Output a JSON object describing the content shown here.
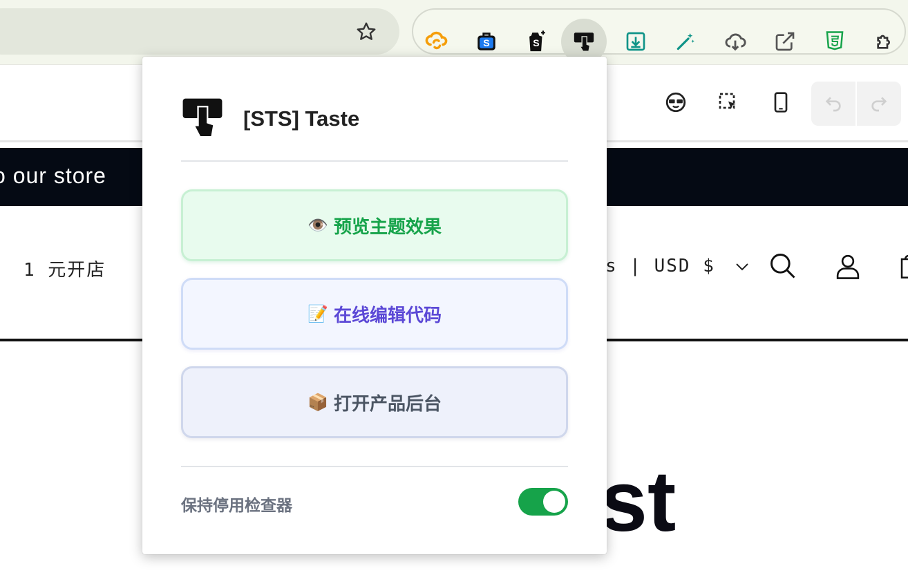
{
  "browser": {
    "extensions": [
      "sync-icon",
      "briefcase-s-icon",
      "shopify-icon",
      "sts-taste-icon",
      "download-box-icon",
      "magic-wand-icon",
      "cloud-download-icon",
      "open-external-icon",
      "html5-icon",
      "puzzle-icon"
    ],
    "active_extension": "sts-taste-icon"
  },
  "page": {
    "banner_text": "o our store",
    "nav_left": "1 元开店",
    "nav_right": "s | USD $",
    "big_text": "st"
  },
  "popup": {
    "title": "[STS] Taste",
    "buttons": {
      "preview": {
        "emoji": "👁️",
        "label": "预览主题效果"
      },
      "code": {
        "emoji": "📝",
        "label": "在线编辑代码"
      },
      "admin": {
        "emoji": "📦",
        "label": "打开产品后台"
      }
    },
    "toggle": {
      "label": "保持停用检查器",
      "on": true
    }
  },
  "colors": {
    "green": "#16a34a",
    "purple": "#5b48d6",
    "gray": "#4b5563",
    "banner": "#050a14"
  }
}
